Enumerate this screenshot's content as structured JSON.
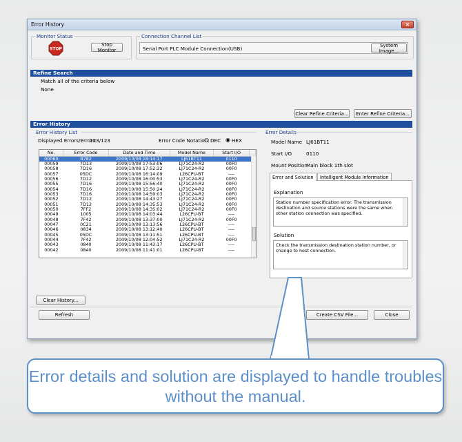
{
  "window": {
    "title": "Error History",
    "close_glyph": "×"
  },
  "monitor_status": {
    "group_label": "Monitor Status",
    "stop_icon_text": "STOP",
    "stop_button": "Stop Monitor"
  },
  "connection": {
    "group_label": "Connection Channel List",
    "value": "Serial Port  PLC Module Connection(USB)",
    "system_image_button": "System Image..."
  },
  "refine": {
    "header": "Refine Search",
    "criteria_text": "Match all of the criteria below",
    "criteria_value": "None",
    "clear_button": "Clear Refine Criteria...",
    "enter_button": "Enter Refine Criteria..."
  },
  "error_history": {
    "header": "Error History",
    "list_label": "Error History List",
    "displayed_label": "Displayed Errors/Errors:",
    "displayed_value": "123/123",
    "notation_label": "Error Code Notation:",
    "notation_dec": "DEC",
    "notation_hex": "HEX",
    "columns": [
      "No.",
      "Error Code",
      "Date and Time",
      "Model Name",
      "Start I/O"
    ],
    "rows": [
      [
        "00060",
        "B782",
        "2009/10/08 18:14:17",
        "LJ61BT11",
        "0110"
      ],
      [
        "00059",
        "7D13",
        "2009/10/08 17:53:06",
        "LJ71C24-R2",
        "00F0"
      ],
      [
        "00058",
        "7D16",
        "2009/10/08 17:52:32",
        "LJ71C24-R2",
        "00F0"
      ],
      [
        "00057",
        "05DC",
        "2009/10/08 16:14:09",
        "L26CPU-BT",
        "----"
      ],
      [
        "00056",
        "7D12",
        "2009/10/08 16:00:53",
        "LJ71C24-R2",
        "00F0"
      ],
      [
        "00055",
        "7D16",
        "2009/10/08 15:56:40",
        "LJ71C24-R2",
        "00F0"
      ],
      [
        "00054",
        "7D16",
        "2009/10/08 15:50:24",
        "LJ71C24-R2",
        "00F0"
      ],
      [
        "00053",
        "7D16",
        "2009/10/08 14:59:03",
        "LJ71C24-R2",
        "00F0"
      ],
      [
        "00052",
        "7D12",
        "2009/10/08 14:43:27",
        "LJ71C24-R2",
        "00F0"
      ],
      [
        "00051",
        "7D12",
        "2009/10/08 14:35:53",
        "LJ71C24-R2",
        "00F0"
      ],
      [
        "00050",
        "7FF2",
        "2009/10/08 14:35:02",
        "LJ71C24-R2",
        "00F0"
      ],
      [
        "00049",
        "1005",
        "2009/10/08 14:03:44",
        "L26CPU-BT",
        "----"
      ],
      [
        "00048",
        "7F42",
        "2009/10/08 13:37:00",
        "LJ71C24-R2",
        "00F0"
      ],
      [
        "00047",
        "0C21",
        "2009/10/08 13:13:56",
        "L26CPU-BT",
        "----"
      ],
      [
        "00046",
        "0834",
        "2009/10/08 13:12:40",
        "L26CPU-BT",
        "----"
      ],
      [
        "00045",
        "05DC",
        "2009/10/08 13:11:51",
        "L26CPU-BT",
        "----"
      ],
      [
        "00044",
        "7F42",
        "2009/10/08 12:04:52",
        "LJ71C24-R2",
        "00F0"
      ],
      [
        "00043",
        "0840",
        "2009/10/08 11:43:17",
        "L26CPU-BT",
        "----"
      ],
      [
        "00042",
        "0840",
        "2009/10/08 11:41:01",
        "L26CPU-BT",
        "----"
      ]
    ],
    "clear_history_button": "Clear History..."
  },
  "details": {
    "label": "Error Details",
    "model_name_label": "Model Name",
    "model_name_value": "LJ61BT11",
    "start_io_label": "Start I/O",
    "start_io_value": "0110",
    "mount_label": "Mount Position",
    "mount_value": "Main block 1th slot",
    "tab_solution": "Error and Solution",
    "tab_intelligent": "Intelligent Module Information",
    "explanation_label": "Explanation",
    "explanation_text": "Station number specification error. The transmission destination and source stations were the same when other station connection was specified.",
    "solution_label": "Solution",
    "solution_text": "Check the transmission destination station number, or change to host connection."
  },
  "footer": {
    "refresh_button": "Refresh",
    "csv_button": "Create CSV File...",
    "close_button": "Close"
  },
  "callout": {
    "text": "Error details and solution are displayed to handle troubles without the manual."
  },
  "colors": {
    "header_blue": "#1f4e9c",
    "selected_row": "#3f77c8",
    "callout_blue": "#5d8fc8",
    "stop_red": "#c8281e"
  }
}
